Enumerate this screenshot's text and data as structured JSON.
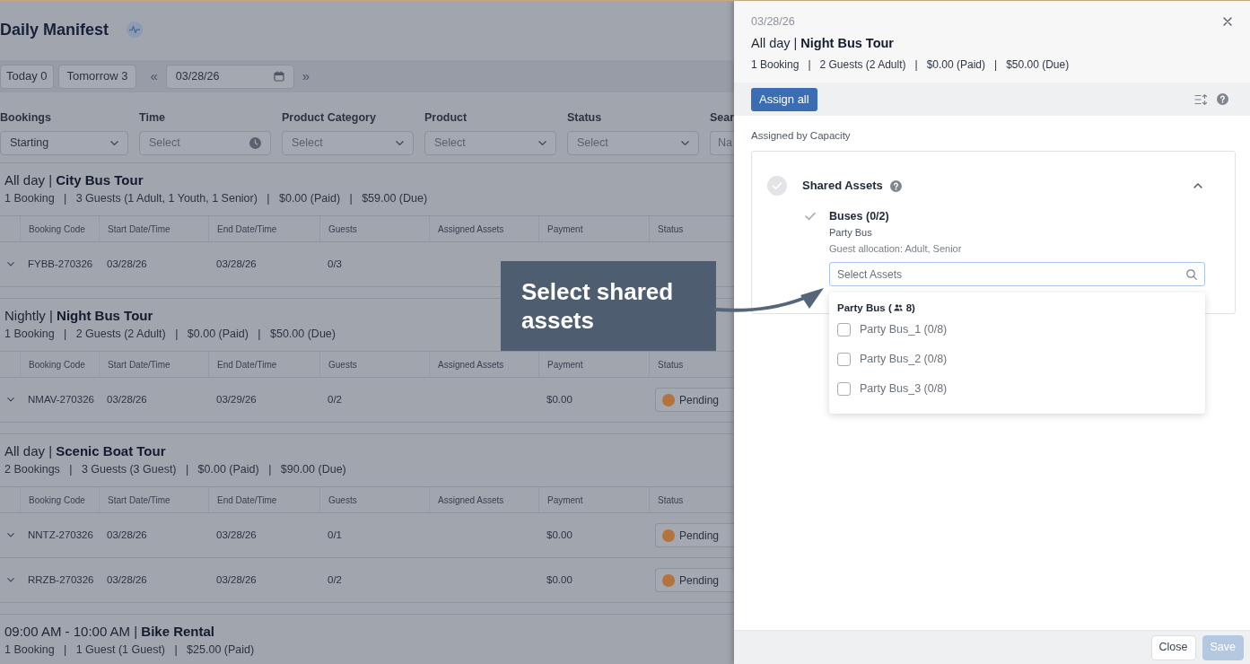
{
  "page": {
    "title": "Daily Manifest"
  },
  "day_buttons": [
    {
      "label": "Today 0"
    },
    {
      "label": "Tomorrow 3"
    }
  ],
  "date_nav": {
    "previous": "«",
    "date": "03/28/26",
    "next": "»"
  },
  "filters": [
    {
      "kind": "select",
      "label": "Bookings",
      "value": "Starting"
    },
    {
      "kind": "time",
      "label": "Time",
      "placeholder": "Select"
    },
    {
      "kind": "select",
      "label": "Product Category",
      "placeholder": "Select"
    },
    {
      "kind": "select",
      "label": "Product",
      "placeholder": "Select"
    },
    {
      "kind": "select",
      "label": "Status",
      "placeholder": "Select"
    },
    {
      "kind": "text",
      "label": "Sear",
      "placeholder": "Na"
    }
  ],
  "groups": [
    {
      "heading": "All day | **City Bus Tour**",
      "summary": "1 Booking   |   3 Guests (1 Adult, 1 Youth, 1 Senior)   |   $0.00 (Paid)   |   $59.00 (Due)",
      "columns": [
        "Booking Code",
        "Start Date/Time",
        "End Date/Time",
        "Guests",
        "Assigned Assets",
        "Payment",
        "Status"
      ],
      "rows": [
        {
          "expanded": false,
          "booking_code": "FYBB-270326",
          "start": "03/28/26",
          "end": "03/28/26",
          "guests": "0/3"
        }
      ]
    },
    {
      "heading": "Nightly | **Night Bus Tour**",
      "summary": "1 Booking   |   2 Guests (2 Adult)   |   $0.00 (Paid)   |   $50.00 (Due)",
      "columns": [
        "Booking Code",
        "Start Date/Time",
        "End Date/Time",
        "Guests",
        "Assigned Assets",
        "Payment",
        "Status"
      ],
      "rows": [
        {
          "expanded": false,
          "booking_code": "NMAV-270326",
          "start": "03/28/26",
          "end": "03/29/26",
          "guests": "0/2",
          "payment": "$0.00",
          "status": "Pending"
        }
      ]
    },
    {
      "heading": "All day | **Scenic Boat Tour**",
      "summary": "2 Bookings   |   3 Guests (3 Guest)   |   $0.00 (Paid)   |   $90.00 (Due)",
      "columns": [
        "Booking Code",
        "Start Date/Time",
        "End Date/Time",
        "Guests",
        "Assigned Assets",
        "Payment",
        "Status"
      ],
      "rows": [
        {
          "expanded": false,
          "booking_code": "NNTZ-270326",
          "start": "03/28/26",
          "end": "03/28/26",
          "guests": "0/1",
          "payment": "$0.00",
          "status": "Pending"
        },
        {
          "expanded": false,
          "booking_code": "RRZB-270326",
          "start": "03/28/26",
          "end": "03/28/26",
          "guests": "0/2",
          "payment": "$0.00",
          "status": "Pending"
        }
      ]
    },
    {
      "heading": "09:00 AM - 10:00 AM | **Bike Rental**",
      "summary": "1 Booking   |   1 Guest (1 Guest)   |   $25.00 (Paid)"
    }
  ],
  "callout": {
    "text": "Select shared assets"
  },
  "panel": {
    "date": "03/28/26",
    "title": "All day | **Night Bus Tour**",
    "summary": "1 Booking   |   2 Guests (2 Adult)   |   $0.00 (Paid)   |   $50.00 (Due)",
    "assign_button": "Assign all",
    "section_label": "Assigned by Capacity",
    "asset_group": {
      "title": "Shared Assets",
      "assigned": false,
      "expanded": true,
      "requirements": [
        {
          "title": "Buses (0/2)",
          "assigned": false,
          "asset_type": "Party Bus",
          "allocation": "Guest allocation: Adult, Senior",
          "search": {
            "placeholder": "Select Assets"
          },
          "dropdown": {
            "group_label_before_icon": "Party Bus (",
            "group_label_after_icon": "8)",
            "options": [
              {
                "label": "Party Bus_1 (0/8)",
                "checked": false
              },
              {
                "label": "Party Bus_2 (0/8)",
                "checked": false
              },
              {
                "label": "Party Bus_3 (0/8)",
                "checked": false
              }
            ]
          }
        }
      ]
    },
    "footer_buttons": [
      {
        "label": "Close",
        "disabled": false
      },
      {
        "label": "Save",
        "disabled": true
      }
    ]
  }
}
